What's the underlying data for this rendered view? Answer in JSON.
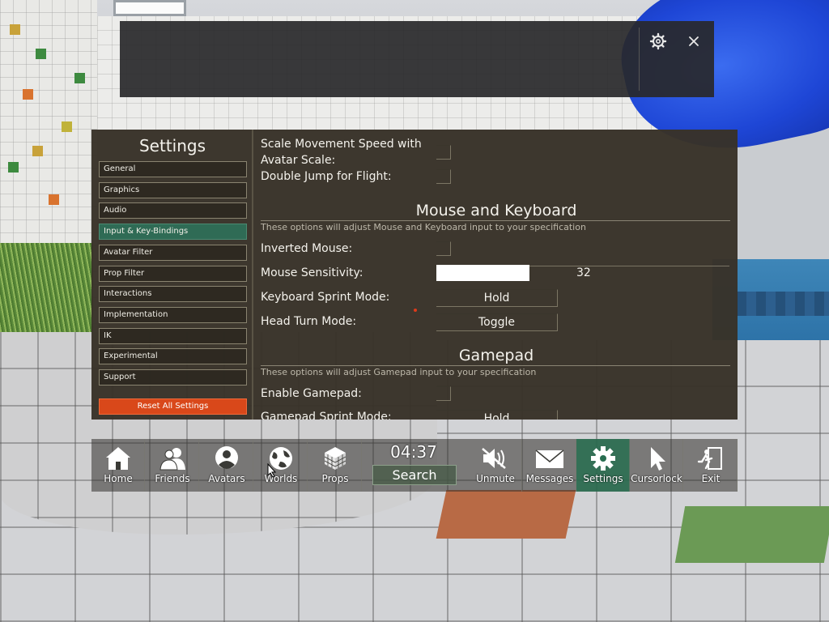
{
  "topbar": {
    "settings_icon": "gear-icon",
    "close_icon": "close-icon",
    "close_glyph": "✕",
    "gear_glyph": "⚙"
  },
  "sidebar": {
    "title": "Settings",
    "items": [
      {
        "label": "General",
        "active": false
      },
      {
        "label": "Graphics",
        "active": false
      },
      {
        "label": "Audio",
        "active": false
      },
      {
        "label": "Input & Key-Bindings",
        "active": true
      },
      {
        "label": "Avatar Filter",
        "active": false
      },
      {
        "label": "Prop Filter",
        "active": false
      },
      {
        "label": "Interactions",
        "active": false
      },
      {
        "label": "Implementation",
        "active": false
      },
      {
        "label": "IK",
        "active": false
      },
      {
        "label": "Experimental",
        "active": false
      },
      {
        "label": "Support",
        "active": false
      }
    ],
    "reset_label": "Reset All Settings"
  },
  "content": {
    "scale_movement_label_line1": "Scale Movement Speed with",
    "scale_movement_label_line2": "Avatar Scale:",
    "double_jump_label": "Double Jump for Flight:",
    "mouse_section": {
      "title": "Mouse and Keyboard",
      "description": "These options will adjust Mouse and Keyboard input to your specification",
      "inverted_mouse_label": "Inverted Mouse:",
      "mouse_sensitivity_label": "Mouse Sensitivity:",
      "mouse_sensitivity_value": "32",
      "mouse_sensitivity_fraction": 0.32,
      "keyboard_sprint_label": "Keyboard Sprint Mode:",
      "keyboard_sprint_value": "Hold",
      "head_turn_label": "Head Turn Mode:",
      "head_turn_value": "Toggle"
    },
    "gamepad_section": {
      "title": "Gamepad",
      "description": "These options will adjust Gamepad input to your specification",
      "enable_gamepad_label": "Enable Gamepad:",
      "gamepad_sprint_label": "Gamepad Sprint Mode:",
      "gamepad_sprint_value": "Hold"
    }
  },
  "taskbar": {
    "clock": "04:37",
    "search_label": "Search",
    "buttons": [
      {
        "label": "Home",
        "icon": "home-icon"
      },
      {
        "label": "Friends",
        "icon": "friends-icon"
      },
      {
        "label": "Avatars",
        "icon": "avatar-icon"
      },
      {
        "label": "Worlds",
        "icon": "globe-icon"
      },
      {
        "label": "Props",
        "icon": "cube-icon"
      },
      {
        "label": "Unmute",
        "icon": "speaker-muted-icon"
      },
      {
        "label": "Messages",
        "icon": "envelope-icon"
      },
      {
        "label": "Settings",
        "icon": "gear-icon",
        "active": true
      },
      {
        "label": "Cursorlock",
        "icon": "cursor-icon"
      },
      {
        "label": "Exit",
        "icon": "exit-icon"
      }
    ]
  },
  "colors": {
    "panel_bg": "#383228",
    "active_item": "#2f6b55",
    "reset_button": "#d9481a",
    "taskbar_active": "#286e50"
  }
}
